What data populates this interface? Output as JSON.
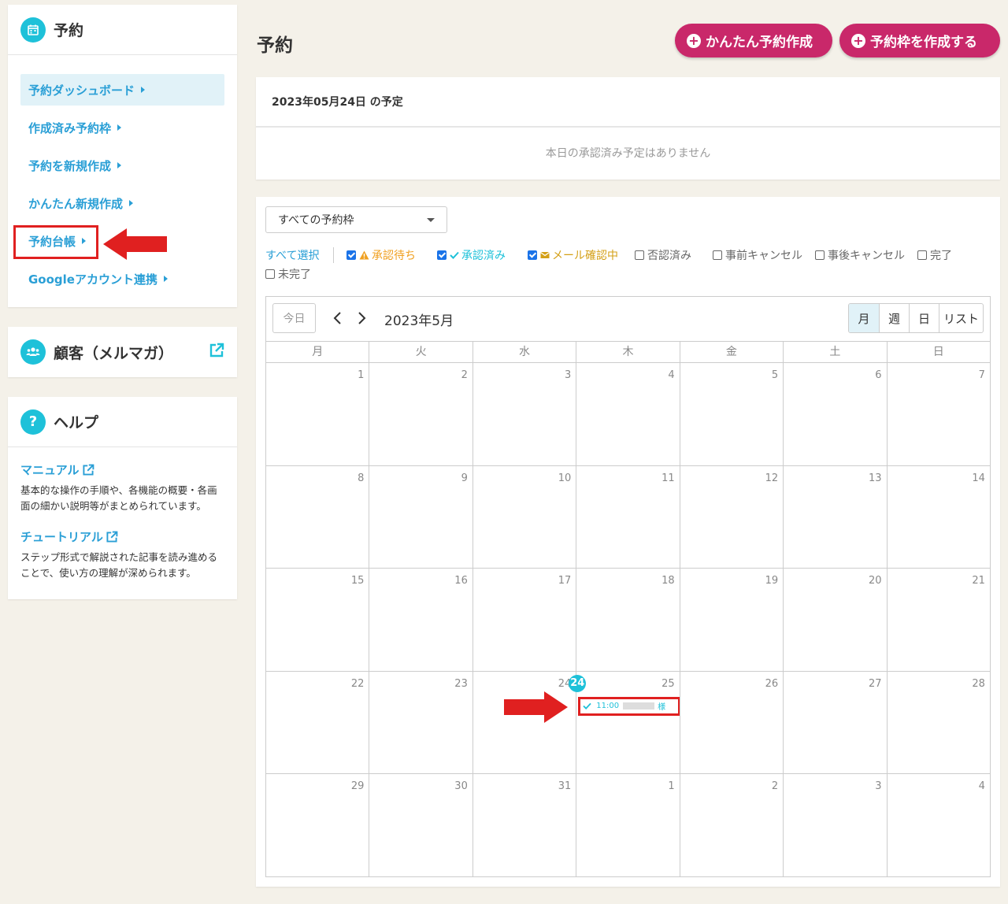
{
  "sidebar": {
    "reservation": {
      "title": "予約",
      "items": [
        {
          "label": "予約ダッシュボード"
        },
        {
          "label": "作成済み予約枠"
        },
        {
          "label": "予約を新規作成"
        },
        {
          "label": "かんたん新規作成"
        },
        {
          "label": "予約台帳"
        },
        {
          "label": "Googleアカウント連携"
        }
      ]
    },
    "customer": {
      "title": "顧客（メルマガ）"
    },
    "help": {
      "title": "ヘルプ",
      "manual_label": "マニュアル",
      "manual_desc": "基本的な操作の手順や、各機能の概要・各画面の細かい説明等がまとめられています。",
      "tutorial_label": "チュートリアル",
      "tutorial_desc": "ステップ形式で解説された記事を読み進めることで、使い方の理解が深められます。"
    }
  },
  "header": {
    "title": "予約",
    "easy_create_label": "かんたん予約作成",
    "create_slot_label": "予約枠を作成する"
  },
  "today": {
    "heading": "2023年05月24日 の予定",
    "empty_message": "本日の承認済み予定はありません"
  },
  "calendar": {
    "slot_select": "すべての予約枠",
    "filters": {
      "select_all": "すべて選択",
      "pending": "承認待ち",
      "approved": "承認済み",
      "mail_confirming": "メール確認中",
      "rejected": "否認済み",
      "pre_cancel": "事前キャンセル",
      "post_cancel": "事後キャンセル",
      "done": "完了",
      "not_done": "未完了"
    },
    "today_button": "今日",
    "title": "2023年5月",
    "views": [
      "月",
      "週",
      "日",
      "リスト"
    ],
    "weekdays": [
      "月",
      "火",
      "水",
      "木",
      "金",
      "土",
      "日"
    ],
    "weeks": [
      [
        "1",
        "2",
        "3",
        "4",
        "5",
        "6",
        "7"
      ],
      [
        "8",
        "9",
        "10",
        "11",
        "12",
        "13",
        "14"
      ],
      [
        "15",
        "16",
        "17",
        "18",
        "19",
        "20",
        "21"
      ],
      [
        "22",
        "23",
        "24",
        "25",
        "26",
        "27",
        "28"
      ],
      [
        "29",
        "30",
        "31",
        "1",
        "2",
        "3",
        "4"
      ]
    ],
    "event_time": "11:00",
    "event_suffix": "様"
  },
  "colors": {
    "accent_teal": "#1ec1d9",
    "link_blue": "#2a9fd6",
    "pink": "#c9286a",
    "pending_orange": "#f0a020",
    "mail_gold": "#d4a017",
    "annotation_red": "#e02020"
  }
}
